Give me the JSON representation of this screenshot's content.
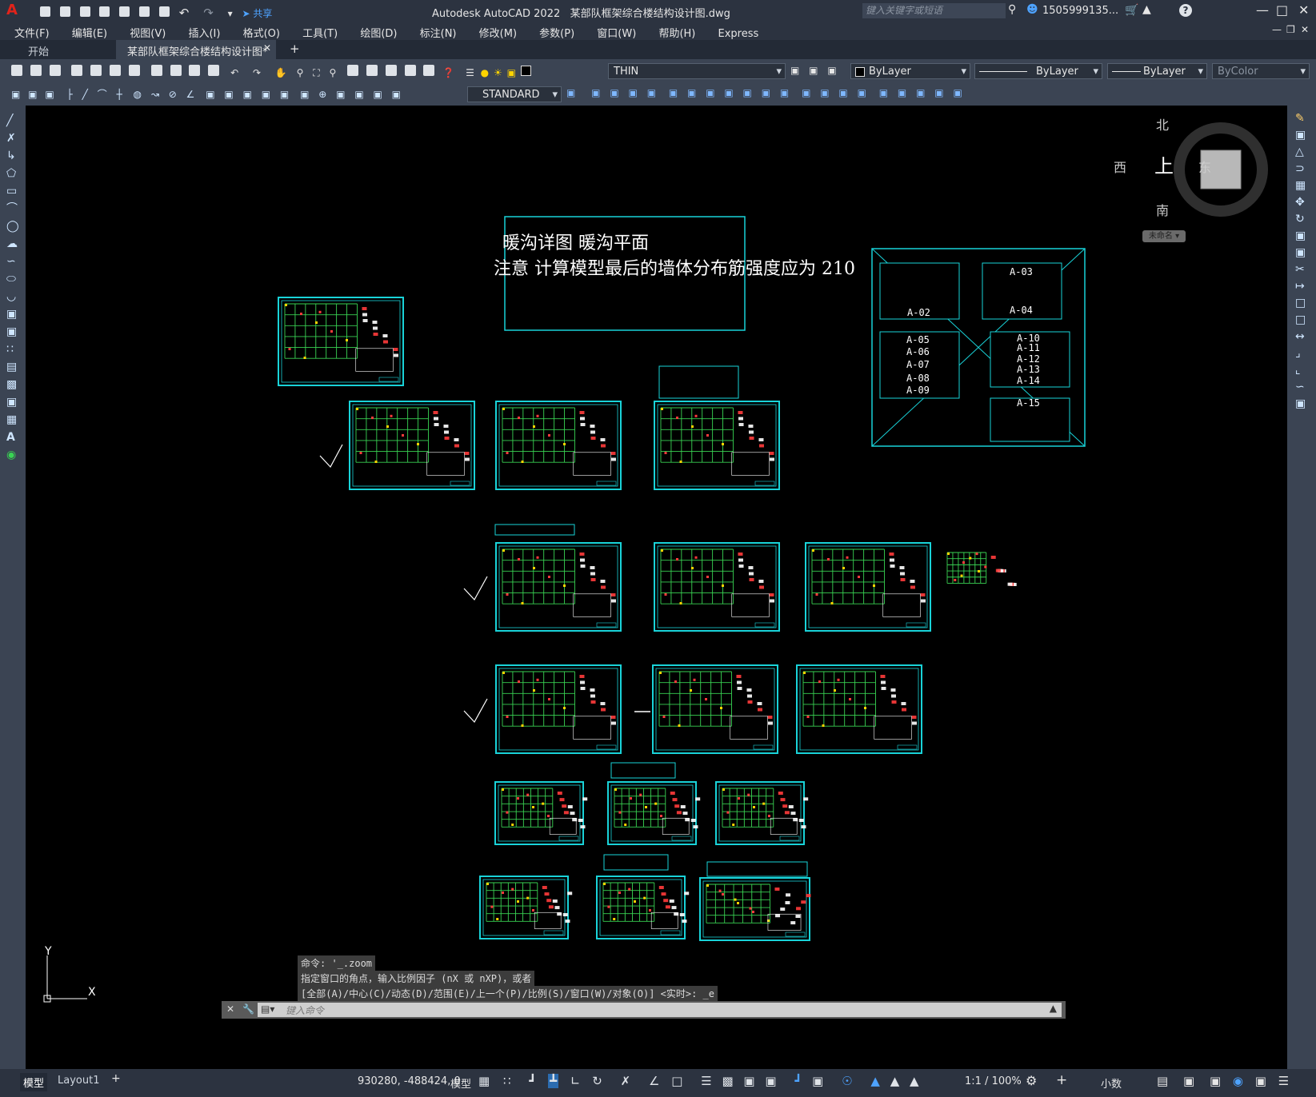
{
  "title": {
    "app": "Autodesk AutoCAD 2022",
    "file": "某部队框架综合楼结构设计图.dwg",
    "share": "共享",
    "search_placeholder": "键入关键字或短语",
    "user": "1505999135..."
  },
  "menu": [
    "文件(F)",
    "编辑(E)",
    "视图(V)",
    "插入(I)",
    "格式(O)",
    "工具(T)",
    "绘图(D)",
    "标注(N)",
    "修改(M)",
    "参数(P)",
    "窗口(W)",
    "帮助(H)",
    "Express"
  ],
  "tabs": {
    "start": "开始",
    "active": "某部队框架综合楼结构设计图*"
  },
  "toolbar": {
    "layer": "THIN",
    "color": "ByLayer",
    "linetype": "ByLayer",
    "lineweight": "ByLayer",
    "plotstyle": "ByColor",
    "textstyle": "STANDARD"
  },
  "viewcube": {
    "north": "北",
    "south": "南",
    "east": "东",
    "west": "西",
    "top": "上",
    "wcs": "未命名"
  },
  "drawing": {
    "note_line1": "暖沟详图  暖沟平面",
    "note_line2": "注意 计算模型最后的墙体分布筋强度应为 210",
    "tags": [
      "A-02",
      "A-03",
      "A-04",
      "A-05",
      "A-06",
      "A-07",
      "A-08",
      "A-09",
      "A-10",
      "A-11",
      "A-12",
      "A-13",
      "A-14",
      "A-15"
    ]
  },
  "ucs": {
    "x": "X",
    "y": "Y"
  },
  "command": {
    "history": [
      "命令: '_.zoom",
      "指定窗口的角点，输入比例因子 (nX 或 nXP)，或者",
      "[全部(A)/中心(C)/动态(D)/范围(E)/上一个(P)/比例(S)/窗口(W)/对象(O)] <实时>: _e"
    ],
    "placeholder": "键入命令"
  },
  "status": {
    "tab_model": "模型",
    "tab_layout": "Layout1",
    "coords": "930280, -488424, 0",
    "space": "模型",
    "scale": "1:1 / 100%",
    "units": "小数"
  }
}
